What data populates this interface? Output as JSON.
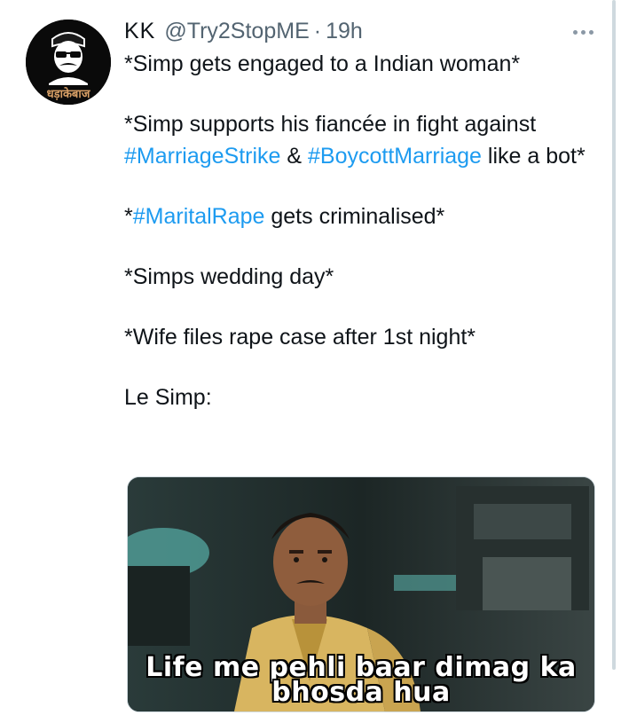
{
  "author": {
    "display_name": "KK",
    "handle": "@Try2StopME",
    "separator": "·",
    "time": "19h",
    "avatar_text": "धड़ाकेबाज"
  },
  "tweet": {
    "line1": "*Simp gets engaged to a Indian woman*",
    "p2_text1": "*Simp supports his fiancée in fight against ",
    "p2_tag1": "#MarriageStrike",
    "p2_amp": " & ",
    "p2_tag2": "#BoycottMarriage",
    "p2_text2": " like a bot*",
    "p3_star": "*",
    "p3_tag": "#MaritalRape",
    "p3_text": " gets criminalised*",
    "p4": "*Simps wedding day*",
    "p5": "*Wife files rape case after 1st night*",
    "p6": "Le Simp:"
  },
  "media": {
    "caption_line1": "Life me pehli baar dimag ka",
    "caption_line2": "bhosda hua"
  },
  "icons": {
    "more": "more-icon"
  },
  "colors": {
    "hashtag": "#1d9bf0",
    "secondary_text": "#536471",
    "primary_text": "#0f1419"
  }
}
